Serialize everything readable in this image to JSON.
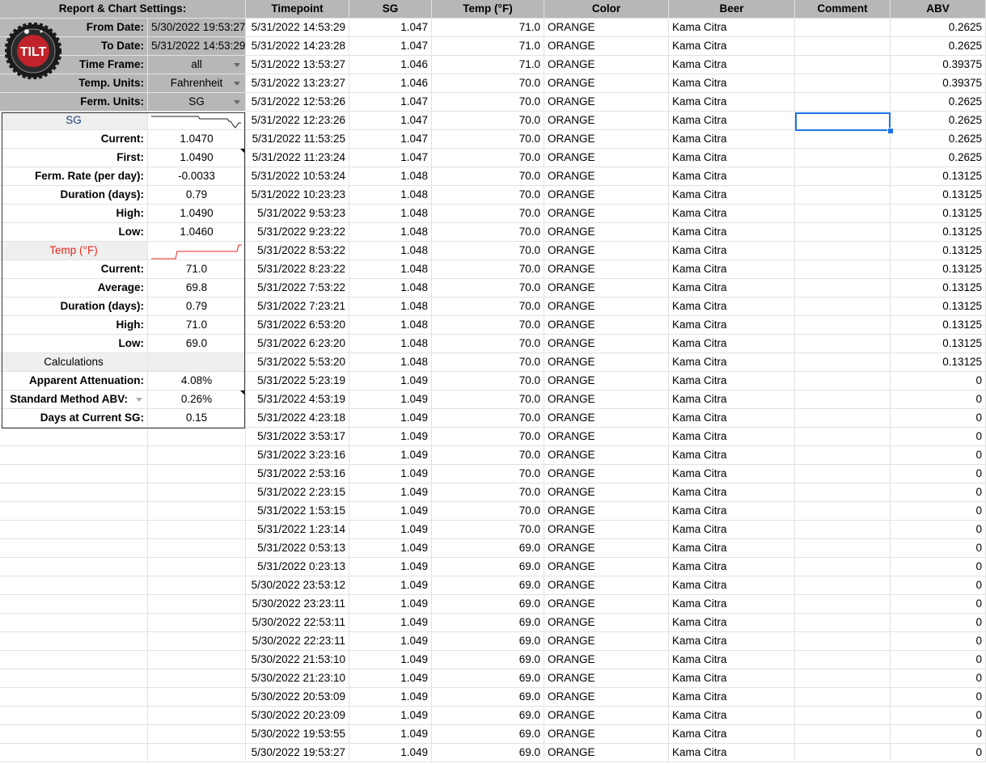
{
  "settings": {
    "title": "Report & Chart Settings:",
    "from_label": "From Date:",
    "from_value": "5/30/2022 19:53:27",
    "to_label": "To Date:",
    "to_value": "5/31/2022 14:53:29",
    "timeframe_label": "Time Frame:",
    "timeframe_value": "all",
    "temp_units_label": "Temp. Units:",
    "temp_units_value": "Fahrenheit",
    "ferm_units_label": "Ferm. Units:",
    "ferm_units_value": "SG",
    "logo_text": "TILT"
  },
  "sg": {
    "header": "SG",
    "current_label": "Current:",
    "current": "1.0470",
    "first_label": "First:",
    "first": "1.0490",
    "rate_label": "Ferm. Rate (per day):",
    "rate": "-0.0033",
    "duration_label": "Duration (days):",
    "duration": "0.79",
    "high_label": "High:",
    "high": "1.0490",
    "low_label": "Low:",
    "low": "1.0460"
  },
  "temp": {
    "header": "Temp (°F)",
    "current_label": "Current:",
    "current": "71.0",
    "average_label": "Average:",
    "average": "69.8",
    "duration_label": "Duration (days):",
    "duration": "0.79",
    "high_label": "High:",
    "high": "71.0",
    "low_label": "Low:",
    "low": "69.0"
  },
  "calc": {
    "header": "Calculations",
    "attenuation_label": "Apparent Attenuation:",
    "attenuation": "4.08%",
    "abv_label": "Standard Method ABV:",
    "abv": "0.26%",
    "days_label": "Days at Current SG:",
    "days": "0.15"
  },
  "table": {
    "columns": [
      "Timepoint",
      "SG",
      "Temp (°F)",
      "Color",
      "Beer",
      "Comment",
      "ABV"
    ],
    "rows": [
      [
        "5/31/2022 14:53:29",
        "1.047",
        "71.0",
        "ORANGE",
        "Kama Citra",
        "",
        "0.2625"
      ],
      [
        "5/31/2022 14:23:28",
        "1.047",
        "71.0",
        "ORANGE",
        "Kama Citra",
        "",
        "0.2625"
      ],
      [
        "5/31/2022 13:53:27",
        "1.046",
        "71.0",
        "ORANGE",
        "Kama Citra",
        "",
        "0.39375"
      ],
      [
        "5/31/2022 13:23:27",
        "1.046",
        "70.0",
        "ORANGE",
        "Kama Citra",
        "",
        "0.39375"
      ],
      [
        "5/31/2022 12:53:26",
        "1.047",
        "70.0",
        "ORANGE",
        "Kama Citra",
        "",
        "0.2625"
      ],
      [
        "5/31/2022 12:23:26",
        "1.047",
        "70.0",
        "ORANGE",
        "Kama Citra",
        "",
        "0.2625"
      ],
      [
        "5/31/2022 11:53:25",
        "1.047",
        "70.0",
        "ORANGE",
        "Kama Citra",
        "",
        "0.2625"
      ],
      [
        "5/31/2022 11:23:24",
        "1.047",
        "70.0",
        "ORANGE",
        "Kama Citra",
        "",
        "0.2625"
      ],
      [
        "5/31/2022 10:53:24",
        "1.048",
        "70.0",
        "ORANGE",
        "Kama Citra",
        "",
        "0.13125"
      ],
      [
        "5/31/2022 10:23:23",
        "1.048",
        "70.0",
        "ORANGE",
        "Kama Citra",
        "",
        "0.13125"
      ],
      [
        "5/31/2022 9:53:23",
        "1.048",
        "70.0",
        "ORANGE",
        "Kama Citra",
        "",
        "0.13125"
      ],
      [
        "5/31/2022 9:23:22",
        "1.048",
        "70.0",
        "ORANGE",
        "Kama Citra",
        "",
        "0.13125"
      ],
      [
        "5/31/2022 8:53:22",
        "1.048",
        "70.0",
        "ORANGE",
        "Kama Citra",
        "",
        "0.13125"
      ],
      [
        "5/31/2022 8:23:22",
        "1.048",
        "70.0",
        "ORANGE",
        "Kama Citra",
        "",
        "0.13125"
      ],
      [
        "5/31/2022 7:53:22",
        "1.048",
        "70.0",
        "ORANGE",
        "Kama Citra",
        "",
        "0.13125"
      ],
      [
        "5/31/2022 7:23:21",
        "1.048",
        "70.0",
        "ORANGE",
        "Kama Citra",
        "",
        "0.13125"
      ],
      [
        "5/31/2022 6:53:20",
        "1.048",
        "70.0",
        "ORANGE",
        "Kama Citra",
        "",
        "0.13125"
      ],
      [
        "5/31/2022 6:23:20",
        "1.048",
        "70.0",
        "ORANGE",
        "Kama Citra",
        "",
        "0.13125"
      ],
      [
        "5/31/2022 5:53:20",
        "1.048",
        "70.0",
        "ORANGE",
        "Kama Citra",
        "",
        "0.13125"
      ],
      [
        "5/31/2022 5:23:19",
        "1.049",
        "70.0",
        "ORANGE",
        "Kama Citra",
        "",
        "0"
      ],
      [
        "5/31/2022 4:53:19",
        "1.049",
        "70.0",
        "ORANGE",
        "Kama Citra",
        "",
        "0"
      ],
      [
        "5/31/2022 4:23:18",
        "1.049",
        "70.0",
        "ORANGE",
        "Kama Citra",
        "",
        "0"
      ],
      [
        "5/31/2022 3:53:17",
        "1.049",
        "70.0",
        "ORANGE",
        "Kama Citra",
        "",
        "0"
      ],
      [
        "5/31/2022 3:23:16",
        "1.049",
        "70.0",
        "ORANGE",
        "Kama Citra",
        "",
        "0"
      ],
      [
        "5/31/2022 2:53:16",
        "1.049",
        "70.0",
        "ORANGE",
        "Kama Citra",
        "",
        "0"
      ],
      [
        "5/31/2022 2:23:15",
        "1.049",
        "70.0",
        "ORANGE",
        "Kama Citra",
        "",
        "0"
      ],
      [
        "5/31/2022 1:53:15",
        "1.049",
        "70.0",
        "ORANGE",
        "Kama Citra",
        "",
        "0"
      ],
      [
        "5/31/2022 1:23:14",
        "1.049",
        "70.0",
        "ORANGE",
        "Kama Citra",
        "",
        "0"
      ],
      [
        "5/31/2022 0:53:13",
        "1.049",
        "69.0",
        "ORANGE",
        "Kama Citra",
        "",
        "0"
      ],
      [
        "5/31/2022 0:23:13",
        "1.049",
        "69.0",
        "ORANGE",
        "Kama Citra",
        "",
        "0"
      ],
      [
        "5/30/2022 23:53:12",
        "1.049",
        "69.0",
        "ORANGE",
        "Kama Citra",
        "",
        "0"
      ],
      [
        "5/30/2022 23:23:11",
        "1.049",
        "69.0",
        "ORANGE",
        "Kama Citra",
        "",
        "0"
      ],
      [
        "5/30/2022 22:53:11",
        "1.049",
        "69.0",
        "ORANGE",
        "Kama Citra",
        "",
        "0"
      ],
      [
        "5/30/2022 22:23:11",
        "1.049",
        "69.0",
        "ORANGE",
        "Kama Citra",
        "",
        "0"
      ],
      [
        "5/30/2022 21:53:10",
        "1.049",
        "69.0",
        "ORANGE",
        "Kama Citra",
        "",
        "0"
      ],
      [
        "5/30/2022 21:23:10",
        "1.049",
        "69.0",
        "ORANGE",
        "Kama Citra",
        "",
        "0"
      ],
      [
        "5/30/2022 20:53:09",
        "1.049",
        "69.0",
        "ORANGE",
        "Kama Citra",
        "",
        "0"
      ],
      [
        "5/30/2022 20:23:09",
        "1.049",
        "69.0",
        "ORANGE",
        "Kama Citra",
        "",
        "0"
      ],
      [
        "5/30/2022 19:53:55",
        "1.049",
        "69.0",
        "ORANGE",
        "Kama Citra",
        "",
        "0"
      ],
      [
        "5/30/2022 19:53:27",
        "1.049",
        "69.0",
        "ORANGE",
        "Kama Citra",
        "",
        "0"
      ]
    ]
  },
  "colors": {
    "header_gray": "#b7b7b7",
    "section_gray": "#efefef",
    "sg_blue": "#1c3f7a",
    "temp_red": "#e8251d",
    "selection_blue": "#1a73e8"
  },
  "icons": [
    "tilt-logo",
    "dropdown-arrow-icon",
    "note-corner-icon"
  ]
}
